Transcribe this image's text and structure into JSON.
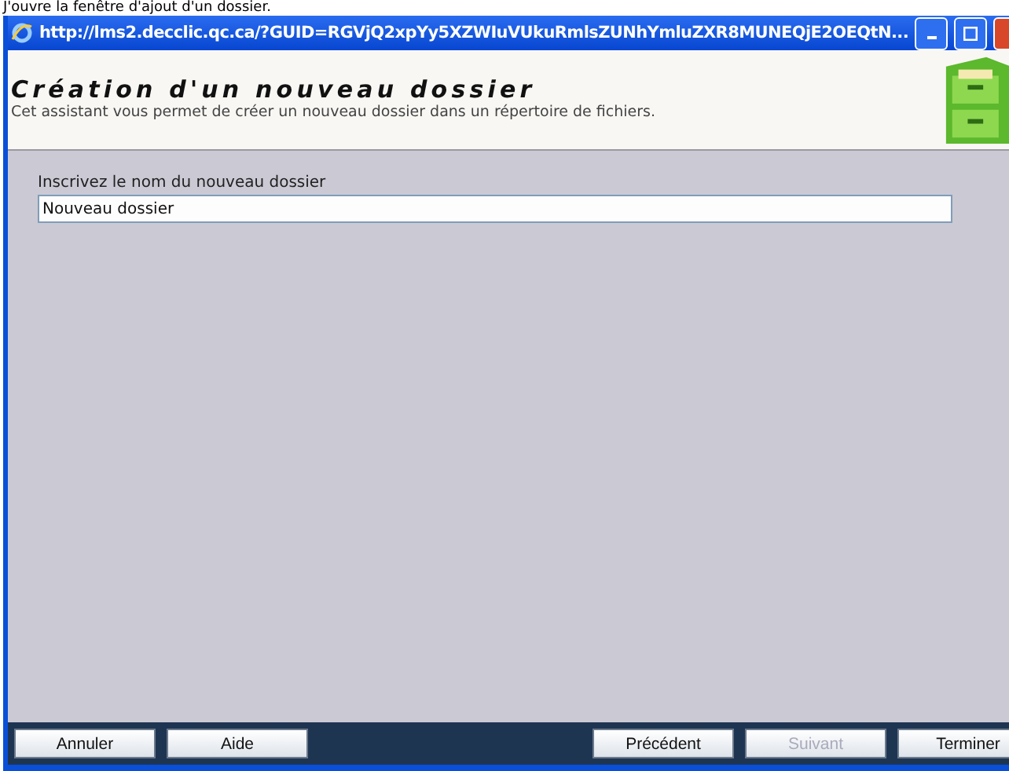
{
  "caption": "J'ouvre la fenêtre d'ajout d'un dossier.",
  "window": {
    "title": "http://lms2.decclic.qc.ca/?GUID=RGVjQ2xpYy5XZWIuVUkuRmlsZUNhYmluZXR8MUNEQjE2OEQtN..."
  },
  "header": {
    "title": "Création d'un nouveau dossier",
    "subtitle": "Cet assistant vous permet de créer un nouveau dossier dans un répertoire de fichiers."
  },
  "field": {
    "label": "Inscrivez le nom du nouveau dossier",
    "value": "Nouveau dossier"
  },
  "left_buttons": [
    {
      "label": "Annuler",
      "disabled": false
    },
    {
      "label": "Aide",
      "disabled": false
    }
  ],
  "right_buttons": [
    {
      "label": "Précédent",
      "disabled": false
    },
    {
      "label": "Suivant",
      "disabled": true
    },
    {
      "label": "Terminer",
      "disabled": false
    }
  ]
}
